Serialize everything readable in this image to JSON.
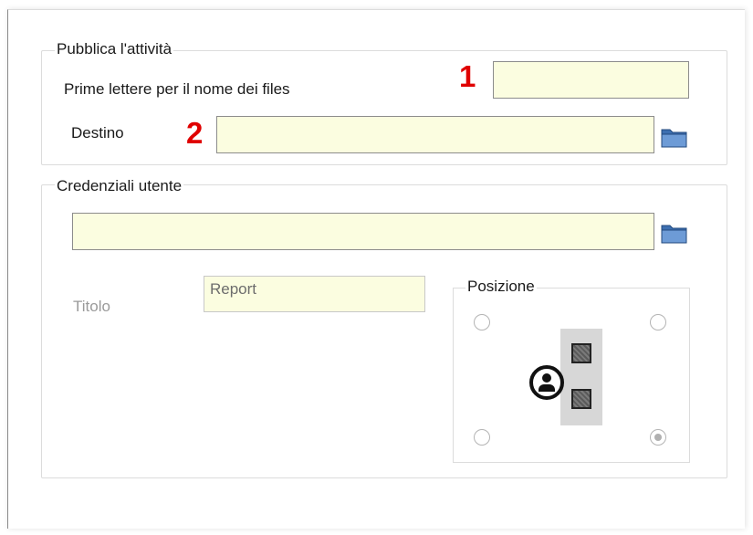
{
  "publish_group": {
    "title": "Pubblica l'attività",
    "prefix_label": "Prime lettere per il nome dei files",
    "prefix_value": "",
    "prefix_marker": "1",
    "destination_label": "Destino",
    "destination_value": "",
    "destination_marker": "2",
    "destination_browse_icon": "folder-icon"
  },
  "credentials_group": {
    "title": "Credenziali utente",
    "path_value": "",
    "path_browse_icon": "folder-icon",
    "title_label": "Titolo",
    "title_value": "Report",
    "position_group": {
      "title": "Posizione",
      "options": [
        {
          "id": "top-left",
          "checked": false
        },
        {
          "id": "top-right",
          "checked": false
        },
        {
          "id": "bottom-left",
          "checked": false
        },
        {
          "id": "bottom-right",
          "checked": true
        }
      ]
    }
  },
  "colors": {
    "input_background": "#fbfde0",
    "marker_red": "#e00000"
  }
}
